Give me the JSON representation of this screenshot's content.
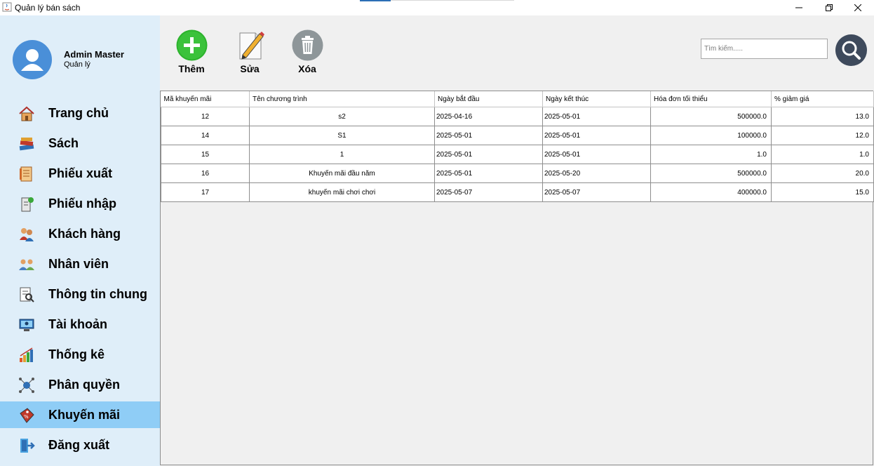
{
  "window": {
    "title": "Quản lý bán sách"
  },
  "user": {
    "name": "Admin Master",
    "role": "Quản lý"
  },
  "sidebar": {
    "items": [
      {
        "label": "Trang chủ",
        "icon": "home-icon"
      },
      {
        "label": "Sách",
        "icon": "books-icon"
      },
      {
        "label": "Phiếu xuất",
        "icon": "export-slip-icon"
      },
      {
        "label": "Phiếu nhập",
        "icon": "import-slip-icon"
      },
      {
        "label": "Khách hàng",
        "icon": "customers-icon"
      },
      {
        "label": "Nhân viên",
        "icon": "employees-icon"
      },
      {
        "label": "Thông tin chung",
        "icon": "general-info-icon"
      },
      {
        "label": "Tài khoản",
        "icon": "account-icon"
      },
      {
        "label": "Thống kê",
        "icon": "statistics-icon"
      },
      {
        "label": "Phân quyền",
        "icon": "permissions-icon"
      },
      {
        "label": "Khuyến mãi",
        "icon": "promotion-icon",
        "active": true
      },
      {
        "label": "Đăng xuất",
        "icon": "logout-icon"
      }
    ]
  },
  "toolbar": {
    "add_label": "Thêm",
    "edit_label": "Sửa",
    "delete_label": "Xóa"
  },
  "search": {
    "placeholder": "Tìm kiếm....."
  },
  "colors": {
    "active_nav": "#8fcdf6",
    "sidebar_bg": "#dfeef9",
    "add_green": "#2db32d"
  },
  "table": {
    "headers": [
      "Mã khuyến mãi",
      "Tên chương trình",
      "Ngày bắt đầu",
      "Ngày kết thúc",
      "Hóa đơn tối thiểu",
      "% giảm giá"
    ],
    "rows": [
      [
        "12",
        "s2",
        "2025-04-16",
        "2025-05-01",
        "500000.0",
        "13.0"
      ],
      [
        "14",
        "S1",
        "2025-05-01",
        "2025-05-01",
        "100000.0",
        "12.0"
      ],
      [
        "15",
        "1",
        "2025-05-01",
        "2025-05-01",
        "1.0",
        "1.0"
      ],
      [
        "16",
        "Khuyến mãi đầu năm",
        "2025-05-01",
        "2025-05-20",
        "500000.0",
        "20.0"
      ],
      [
        "17",
        "khuyến mãi chơi chơi",
        "2025-05-07",
        "2025-05-07",
        "400000.0",
        "15.0"
      ]
    ]
  }
}
